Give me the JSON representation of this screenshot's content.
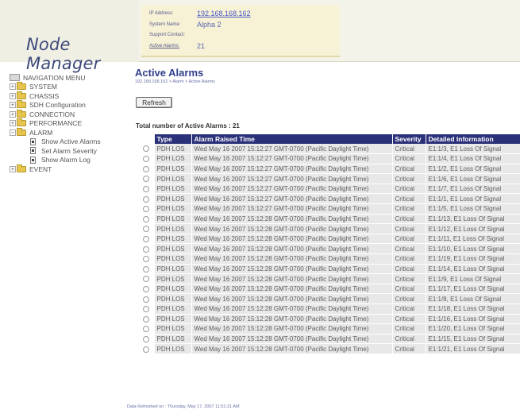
{
  "app": {
    "logo": "Node Manager"
  },
  "header": {
    "ip_address_label": "IP Address:",
    "ip_address_value": "192.168.168.162",
    "system_name_label": "System Name:",
    "system_name_value": "Alpha 2",
    "support_contact_label": "Support Contact:",
    "support_contact_value": "",
    "active_alarms_label": "Active Alarms:",
    "active_alarms_value": "21"
  },
  "nav": {
    "root": "NAVIGATION MENU",
    "items": [
      {
        "label": "SYSTEM",
        "expander": "+"
      },
      {
        "label": "CHASSIS",
        "expander": "+"
      },
      {
        "label": "SDH Configuration",
        "expander": "+"
      },
      {
        "label": "CONNECTION",
        "expander": "+"
      },
      {
        "label": "PERFORMANCE",
        "expander": "+"
      },
      {
        "label": "ALARM",
        "expander": "−"
      },
      {
        "label": "EVENT",
        "expander": "+"
      }
    ],
    "alarm_children": [
      "Show Active Alarms",
      "Set Alarm Severity",
      "Show Alarm Log"
    ]
  },
  "main": {
    "title": "Active Alarms",
    "breadcrumb": "192.168.168.162 > Alarm > Active Alarms",
    "refresh_label": "Refresh",
    "total_label": "Total number of Active Alarms : 21",
    "footer": "Data Refreshed on : Thursday, May 17, 2007 11:51:21 AM"
  },
  "table": {
    "columns": [
      "Type",
      "Alarm Raised Time",
      "Severity",
      "Detailed Information"
    ],
    "rows": [
      [
        "PDH LOS",
        "Wed May 16 2007 15:12:27 GMT-0700 (Pacific Daylight Time)",
        "Critical",
        "E1:1/3, E1 Loss Of Signal"
      ],
      [
        "PDH LOS",
        "Wed May 16 2007 15:12:27 GMT-0700 (Pacific Daylight Time)",
        "Critical",
        "E1:1/4, E1 Loss Of Signal"
      ],
      [
        "PDH LOS",
        "Wed May 16 2007 15:12:27 GMT-0700 (Pacific Daylight Time)",
        "Critical",
        "E1:1/2, E1 Loss Of Signal"
      ],
      [
        "PDH LOS",
        "Wed May 16 2007 15:12:27 GMT-0700 (Pacific Daylight Time)",
        "Critical",
        "E1:1/6, E1 Loss Of Signal"
      ],
      [
        "PDH LOS",
        "Wed May 16 2007 15:12:27 GMT-0700 (Pacific Daylight Time)",
        "Critical",
        "E1:1/7, E1 Loss Of Signal"
      ],
      [
        "PDH LOS",
        "Wed May 16 2007 15:12:27 GMT-0700 (Pacific Daylight Time)",
        "Critical",
        "E1:1/1, E1 Loss Of Signal"
      ],
      [
        "PDH LOS",
        "Wed May 16 2007 15:12:27 GMT-0700 (Pacific Daylight Time)",
        "Critical",
        "E1:1/5, E1 Loss Of Signal"
      ],
      [
        "PDH LOS",
        "Wed May 16 2007 15:12:28 GMT-0700 (Pacific Daylight Time)",
        "Critical",
        "E1:1/13, E1 Loss Of Signal"
      ],
      [
        "PDH LOS",
        "Wed May 16 2007 15:12:28 GMT-0700 (Pacific Daylight Time)",
        "Critical",
        "E1:1/12, E1 Loss Of Signal"
      ],
      [
        "PDH LOS",
        "Wed May 16 2007 15:12:28 GMT-0700 (Pacific Daylight Time)",
        "Critical",
        "E1:1/11, E1 Loss Of Signal"
      ],
      [
        "PDH LOS",
        "Wed May 16 2007 15:12:28 GMT-0700 (Pacific Daylight Time)",
        "Critical",
        "E1:1/10, E1 Loss Of Signal"
      ],
      [
        "PDH LOS",
        "Wed May 16 2007 15:12:28 GMT-0700 (Pacific Daylight Time)",
        "Critical",
        "E1:1/19, E1 Loss Of Signal"
      ],
      [
        "PDH LOS",
        "Wed May 16 2007 15:12:28 GMT-0700 (Pacific Daylight Time)",
        "Critical",
        "E1:1/14, E1 Loss Of Signal"
      ],
      [
        "PDH LOS",
        "Wed May 16 2007 15:12:28 GMT-0700 (Pacific Daylight Time)",
        "Critical",
        "E1:1/9, E1 Loss Of Signal"
      ],
      [
        "PDH LOS",
        "Wed May 16 2007 15:12:28 GMT-0700 (Pacific Daylight Time)",
        "Critical",
        "E1:1/17, E1 Loss Of Signal"
      ],
      [
        "PDH LOS",
        "Wed May 16 2007 15:12:28 GMT-0700 (Pacific Daylight Time)",
        "Critical",
        "E1:1/8, E1 Loss Of Signal"
      ],
      [
        "PDH LOS",
        "Wed May 16 2007 15:12:28 GMT-0700 (Pacific Daylight Time)",
        "Critical",
        "E1:1/18, E1 Loss Of Signal"
      ],
      [
        "PDH LOS",
        "Wed May 16 2007 15:12:28 GMT-0700 (Pacific Daylight Time)",
        "Critical",
        "E1:1/16, E1 Loss Of Signal"
      ],
      [
        "PDH LOS",
        "Wed May 16 2007 15:12:28 GMT-0700 (Pacific Daylight Time)",
        "Critical",
        "E1:1/20, E1 Loss Of Signal"
      ],
      [
        "PDH LOS",
        "Wed May 16 2007 15:12:28 GMT-0700 (Pacific Daylight Time)",
        "Critical",
        "E1:1/15, E1 Loss Of Signal"
      ],
      [
        "PDH LOS",
        "Wed May 16 2007 15:12:28 GMT-0700 (Pacific Daylight Time)",
        "Critical",
        "E1:1/21, E1 Loss Of Signal"
      ]
    ]
  },
  "colors": {
    "table_header": "#2b3178",
    "title": "#2f3f8a",
    "row_bg": "#e8e8e8",
    "info_box": "#f7f2d6"
  },
  "icons": {
    "folder": "folder-icon",
    "page": "page-icon",
    "radio": "radio-button",
    "nav_root": "navigation-menu-icon"
  }
}
